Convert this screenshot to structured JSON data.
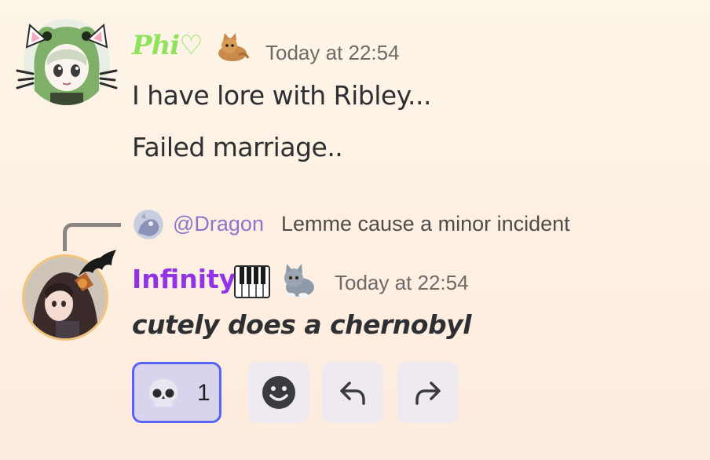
{
  "messages": [
    {
      "username": "Phi♡",
      "timestamp": "Today at 22:54",
      "lines": [
        "I have lore with Ribley...",
        "Failed marriage.."
      ],
      "username_color": "#8fe35c",
      "avatar_icon": "frog-hood-girl-avatar",
      "role_icon": "cat-role-icon"
    },
    {
      "username": "Infinity",
      "username_suffix_icon": "piano-emoji",
      "timestamp": "Today at 22:54",
      "text": "cutely does a chernobyl",
      "username_color": "#9333e6",
      "avatar_icon": "anime-girl-avatar",
      "role_icon": "grey-kitten-role-icon",
      "reply": {
        "mention": "@Dragon",
        "text": "Lemme cause a minor incident",
        "avatar_icon": "dragon-avatar"
      },
      "reactions": [
        {
          "emoji": "skull-emoji",
          "count": "1",
          "active": true
        }
      ]
    }
  ],
  "actions": [
    {
      "name": "add-reaction",
      "icon": "smiley-icon"
    },
    {
      "name": "reply",
      "icon": "reply-arrow-icon"
    },
    {
      "name": "forward",
      "icon": "forward-arrow-icon"
    }
  ],
  "colors": {
    "background_top": "#fdf5e8",
    "background_bottom": "#fdebdd",
    "mention": "#8a77cc",
    "reaction_border": "#5865f2",
    "reaction_bg": "#d8d4ee",
    "timestamp": "#6d6a68"
  }
}
